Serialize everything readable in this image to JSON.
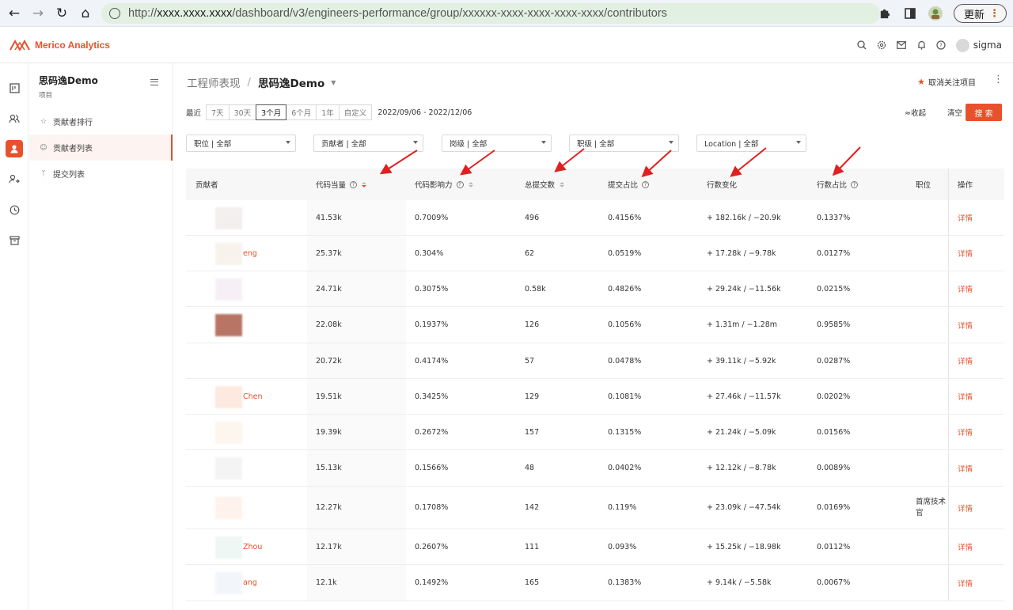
{
  "browser": {
    "url_prefix": "http://",
    "url_host": "xxxx.xxxx.xxxx",
    "url_path": "/dashboard/v3/engineers-performance/group/xxxxxx-xxxx-xxxx-xxxx-xxxx/contributors",
    "update_label": "更新"
  },
  "app": {
    "logo_text": "Merico Analytics",
    "user_name": "sigma"
  },
  "sidebar": {
    "project_name": "思码逸Demo",
    "project_sub": "项目",
    "items": [
      {
        "label": "贡献者排行",
        "icon": "trophy-icon"
      },
      {
        "label": "贡献者列表",
        "icon": "smile-icon"
      },
      {
        "label": "提交列表",
        "icon": "branch-icon"
      }
    ]
  },
  "page": {
    "crumb_parent": "工程师表现",
    "crumb_sep": "/",
    "crumb_current": "思码逸Demo",
    "unfollow_label": "取消关注项目",
    "range_label": "最近",
    "ranges": [
      "7天",
      "30天",
      "3个月",
      "6个月",
      "1年",
      "自定义"
    ],
    "selected_range": "3个月",
    "date_range": "2022/09/06 - 2022/12/06",
    "collapse_label": "≈收起",
    "clear_label": "清空",
    "search_label": "搜 索",
    "filters": [
      "职位 | 全部",
      "贡献者 | 全部",
      "岗级 | 全部",
      "职级 | 全部",
      "Location | 全部"
    ]
  },
  "table": {
    "headers": {
      "contributor": "贡献者",
      "equiv": "代码当量",
      "impact": "代码影响力",
      "commits": "总提交数",
      "commit_share": "提交占比",
      "line_change": "行数变化",
      "line_share": "行数占比",
      "position": "职位",
      "action": "操作"
    },
    "rows": [
      {
        "name": "",
        "equiv": "41.53k",
        "impact": "0.7009%",
        "commits": "496",
        "commit_share": "0.4156%",
        "line_change": "+ 182.16k / −20.9k",
        "line_share": "0.1337%",
        "position": "",
        "action": "详情"
      },
      {
        "name": "eng",
        "equiv": "25.37k",
        "impact": "0.304%",
        "commits": "62",
        "commit_share": "0.0519%",
        "line_change": "+ 17.28k / −9.78k",
        "line_share": "0.0127%",
        "position": "",
        "action": "详情"
      },
      {
        "name": "",
        "equiv": "24.71k",
        "impact": "0.3075%",
        "commits": "0.58k",
        "commit_share": "0.4826%",
        "line_change": "+ 29.24k / −11.56k",
        "line_share": "0.0215%",
        "position": "",
        "action": "详情"
      },
      {
        "name": "",
        "equiv": "22.08k",
        "impact": "0.1937%",
        "commits": "126",
        "commit_share": "0.1056%",
        "line_change": "+ 1.31m / −1.28m",
        "line_share": "0.9585%",
        "position": "",
        "action": "详情"
      },
      {
        "name": "",
        "equiv": "20.72k",
        "impact": "0.4174%",
        "commits": "57",
        "commit_share": "0.0478%",
        "line_change": "+ 39.11k / −5.92k",
        "line_share": "0.0287%",
        "position": "",
        "action": "详情"
      },
      {
        "name": "Chen",
        "equiv": "19.51k",
        "impact": "0.3425%",
        "commits": "129",
        "commit_share": "0.1081%",
        "line_change": "+ 27.46k / −11.57k",
        "line_share": "0.0202%",
        "position": "",
        "action": "详情"
      },
      {
        "name": "",
        "equiv": "19.39k",
        "impact": "0.2672%",
        "commits": "157",
        "commit_share": "0.1315%",
        "line_change": "+ 21.24k / −5.09k",
        "line_share": "0.0156%",
        "position": "",
        "action": "详情"
      },
      {
        "name": "",
        "equiv": "15.13k",
        "impact": "0.1566%",
        "commits": "48",
        "commit_share": "0.0402%",
        "line_change": "+ 12.12k / −8.78k",
        "line_share": "0.0089%",
        "position": "",
        "action": "详情"
      },
      {
        "name": "",
        "equiv": "12.27k",
        "impact": "0.1708%",
        "commits": "142",
        "commit_share": "0.119%",
        "line_change": "+ 23.09k / −47.54k",
        "line_share": "0.0169%",
        "position": "首席技术\n官",
        "action": "详情"
      },
      {
        "name": "Zhou",
        "equiv": "12.17k",
        "impact": "0.2607%",
        "commits": "111",
        "commit_share": "0.093%",
        "line_change": "+ 15.25k / −18.98k",
        "line_share": "0.0112%",
        "position": "",
        "action": "详情"
      },
      {
        "name": "ang",
        "equiv": "12.1k",
        "impact": "0.1492%",
        "commits": "165",
        "commit_share": "0.1383%",
        "line_change": "+ 9.14k / −5.58k",
        "line_share": "0.0067%",
        "position": "",
        "action": "详情"
      }
    ]
  },
  "colors": {
    "accent": "#e8512d",
    "arrow": "#e02020"
  }
}
